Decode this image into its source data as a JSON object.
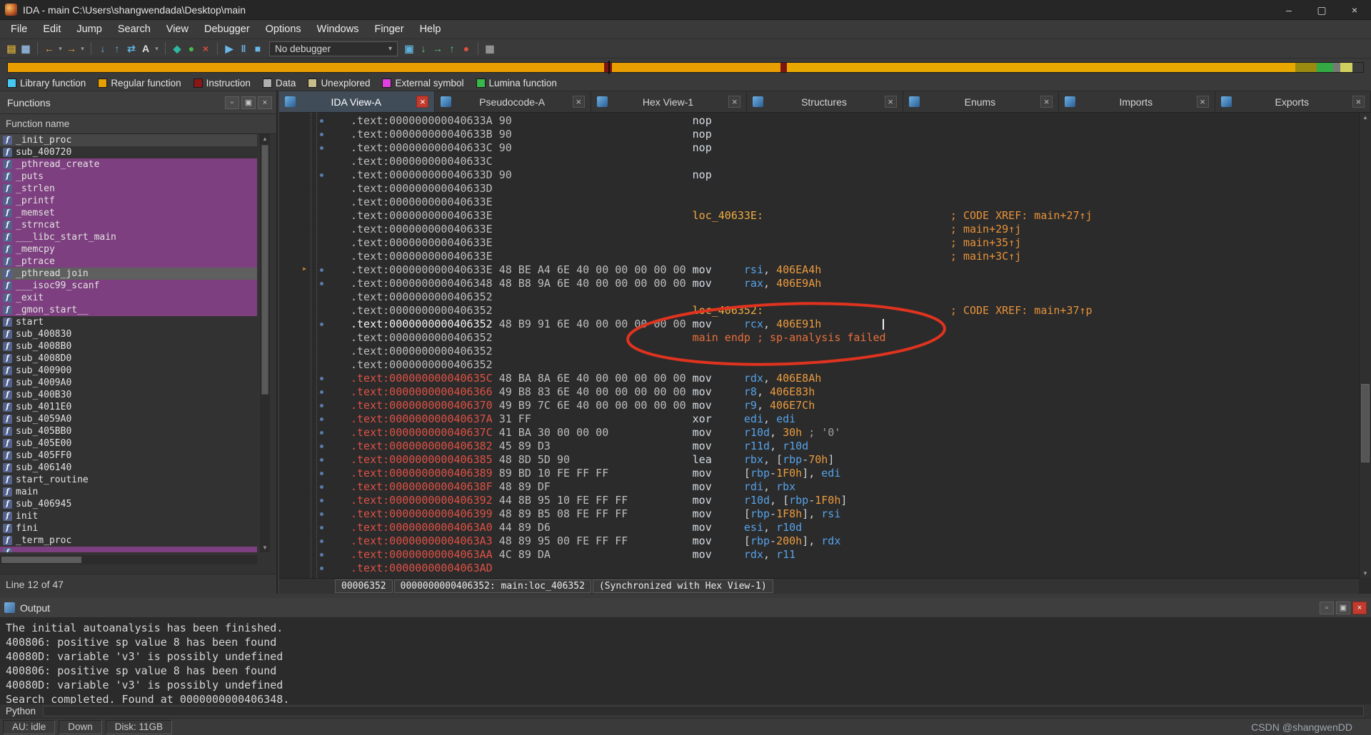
{
  "window": {
    "title": "IDA - main C:\\Users\\shangwendada\\Desktop\\main",
    "controls": [
      {
        "name": "minimize-button",
        "glyph": "–"
      },
      {
        "name": "maximize-button",
        "glyph": "▢"
      },
      {
        "name": "close-button",
        "glyph": "×"
      }
    ]
  },
  "menu": [
    "File",
    "Edit",
    "Jump",
    "Search",
    "View",
    "Debugger",
    "Options",
    "Windows",
    "Finger",
    "Help"
  ],
  "toolbar": {
    "debugger_combo": "No debugger",
    "icons_left": [
      {
        "name": "new-file-icon",
        "glyph": "▤",
        "color": "#caa43a"
      },
      {
        "name": "save-file-icon",
        "glyph": "▦",
        "color": "#8fb4d8"
      },
      {
        "sep": true
      },
      {
        "name": "navigate-back-icon",
        "glyph": "←",
        "color": "#e8a33d"
      },
      {
        "name": "navigate-back-dropdown-icon",
        "glyph": "▾",
        "color": "#9a9a9a",
        "small": true
      },
      {
        "name": "navigate-forward-icon",
        "glyph": "→",
        "color": "#e8a33d"
      },
      {
        "name": "navigate-forward-dropdown-icon",
        "glyph": "▾",
        "color": "#9a9a9a",
        "small": true
      },
      {
        "sep": true
      },
      {
        "name": "jump-to-address-icon",
        "glyph": "↓",
        "color": "#5fb0d8"
      },
      {
        "name": "jump-by-name-icon",
        "glyph": "↑",
        "color": "#5fb0d8"
      },
      {
        "name": "jump-xref-icon",
        "glyph": "⇄",
        "color": "#5fb0d8"
      },
      {
        "name": "search-text-icon",
        "glyph": "A",
        "color": "#e0e0e0"
      },
      {
        "name": "search-dropdown-icon",
        "glyph": "▾",
        "color": "#9a9a9a",
        "small": true
      },
      {
        "sep": true
      },
      {
        "name": "analysis-indicator-icon",
        "glyph": "◆",
        "color": "#2fb8a0"
      },
      {
        "name": "analysis-ok-icon",
        "glyph": "●",
        "color": "#4ab84a"
      },
      {
        "name": "cancel-analysis-icon",
        "glyph": "×",
        "color": "#d85040"
      },
      {
        "sep": true
      },
      {
        "name": "debugger-start-icon",
        "glyph": "▶",
        "color": "#6ab8e8"
      },
      {
        "name": "debugger-pause-icon",
        "glyph": "‖",
        "color": "#6ab8e8"
      },
      {
        "name": "debugger-stop-icon",
        "glyph": "■",
        "color": "#6ab8e8"
      }
    ],
    "icons_right": [
      {
        "name": "debugger-attach-icon",
        "glyph": "▣",
        "color": "#5fb0d8"
      },
      {
        "name": "step-into-icon",
        "glyph": "↓",
        "color": "#58c878"
      },
      {
        "name": "step-over-icon",
        "glyph": "→",
        "color": "#58c878"
      },
      {
        "name": "run-until-return-icon",
        "glyph": "↑",
        "color": "#58c878"
      },
      {
        "name": "breakpoints-icon",
        "glyph": "●",
        "color": "#d85040"
      },
      {
        "sep": true
      },
      {
        "name": "snapshot-icon",
        "glyph": "▦",
        "color": "#9a9a9a"
      }
    ]
  },
  "navband": {
    "segments": [
      {
        "c": "#e89e00",
        "w": "44%"
      },
      {
        "c": "#7d1414",
        "w": "0.6%"
      },
      {
        "c": "#e89e00",
        "w": "12.4%"
      },
      {
        "c": "#7d1414",
        "w": "0.5%"
      },
      {
        "c": "#e8a800",
        "w": "37.5%"
      },
      {
        "c": "#9a8a10",
        "w": "1.6%"
      },
      {
        "c": "#34aa44",
        "w": "1.2%"
      },
      {
        "c": "#777777",
        "w": "0.5%"
      },
      {
        "c": "#cfcf60",
        "w": "0.9%"
      },
      {
        "c": "#3a3a3a",
        "w": "0.8%"
      }
    ],
    "marker_pos": "44.3%"
  },
  "legend": [
    {
      "label": "Library function",
      "color": "#46c8f0"
    },
    {
      "label": "Regular function",
      "color": "#e8a000"
    },
    {
      "label": "Instruction",
      "color": "#8a1616"
    },
    {
      "label": "Data",
      "color": "#b0b0b0"
    },
    {
      "label": "Unexplored",
      "color": "#c8bc8a"
    },
    {
      "label": "External symbol",
      "color": "#e040e0"
    },
    {
      "label": "Lumina function",
      "color": "#38b848"
    }
  ],
  "tabs": [
    {
      "label": "IDA View-A",
      "active": true
    },
    {
      "label": "Pseudocode-A",
      "active": false
    },
    {
      "label": "Hex View-1",
      "active": false
    },
    {
      "label": "Structures",
      "active": false
    },
    {
      "label": "Enums",
      "active": false
    },
    {
      "label": "Imports",
      "active": false
    },
    {
      "label": "Exports",
      "active": false
    }
  ],
  "functions_panel": {
    "title": "Functions",
    "column_header": "Function name",
    "status": "Line 12 of 47",
    "buttons": [
      {
        "name": "restore-button",
        "glyph": "▫"
      },
      {
        "name": "float-button",
        "glyph": "▣"
      },
      {
        "name": "close-button",
        "glyph": "×"
      }
    ],
    "items": [
      {
        "name": "_init_proc",
        "style": "focus"
      },
      {
        "name": "sub_400720",
        "style": ""
      },
      {
        "name": "_pthread_create",
        "style": "lib"
      },
      {
        "name": "_puts",
        "style": "lib"
      },
      {
        "name": "_strlen",
        "style": "lib"
      },
      {
        "name": "_printf",
        "style": "lib"
      },
      {
        "name": "_memset",
        "style": "lib"
      },
      {
        "name": "_strncat",
        "style": "lib"
      },
      {
        "name": "___libc_start_main",
        "style": "lib"
      },
      {
        "name": "_memcpy",
        "style": "lib"
      },
      {
        "name": "_ptrace",
        "style": "lib"
      },
      {
        "name": "_pthread_join",
        "style": "selected"
      },
      {
        "name": "___isoc99_scanf",
        "style": "lib"
      },
      {
        "name": "_exit",
        "style": "lib"
      },
      {
        "name": "_gmon_start__",
        "style": "lib"
      },
      {
        "name": "start",
        "style": ""
      },
      {
        "name": "sub_400830",
        "style": ""
      },
      {
        "name": "sub_4008B0",
        "style": ""
      },
      {
        "name": "sub_4008D0",
        "style": ""
      },
      {
        "name": "sub_400900",
        "style": ""
      },
      {
        "name": "sub_4009A0",
        "style": ""
      },
      {
        "name": "sub_400B30",
        "style": ""
      },
      {
        "name": "sub_4011E0",
        "style": ""
      },
      {
        "name": "sub_4059A0",
        "style": ""
      },
      {
        "name": "sub_405BB0",
        "style": ""
      },
      {
        "name": "sub_405E00",
        "style": ""
      },
      {
        "name": "sub_405FF0",
        "style": ""
      },
      {
        "name": "sub_406140",
        "style": ""
      },
      {
        "name": "start_routine",
        "style": ""
      },
      {
        "name": "main",
        "style": ""
      },
      {
        "name": "sub_406945",
        "style": ""
      },
      {
        "name": "init",
        "style": ""
      },
      {
        "name": "fini",
        "style": ""
      },
      {
        "name": "_term_proc",
        "style": ""
      },
      {
        "name": "",
        "style": "lib"
      }
    ]
  },
  "disasm": {
    "status": [
      "00006352",
      "0000000000406352: main:loc_406352",
      "(Synchronized with Hex View-1)"
    ],
    "annotation_color": "#e0331f",
    "lines": [
      {
        "addr": ".text:000000000040633A",
        "bytes": "90",
        "mnem": "nop",
        "dot": true
      },
      {
        "addr": ".text:000000000040633B",
        "bytes": "90",
        "mnem": "nop",
        "dot": true
      },
      {
        "addr": ".text:000000000040633C",
        "bytes": "90",
        "mnem": "nop",
        "dot": true
      },
      {
        "addr": ".text:000000000040633C"
      },
      {
        "addr": ".text:000000000040633D",
        "bytes": "90",
        "mnem": "nop",
        "dot": true
      },
      {
        "addr": ".text:000000000040633D"
      },
      {
        "addr": ".text:000000000040633E"
      },
      {
        "addr": ".text:000000000040633E",
        "label": "loc_40633E:",
        "comment": "; CODE XREF: main+27↑j"
      },
      {
        "addr": ".text:000000000040633E",
        "comment": "; main+29↑j"
      },
      {
        "addr": ".text:000000000040633E",
        "comment": "; main+35↑j"
      },
      {
        "addr": ".text:000000000040633E",
        "comment": "; main+3C↑j"
      },
      {
        "addr": ".text:000000000040633E",
        "bytes": "48 BE A4 6E 40 00 00 00 00 00",
        "mnem": "mov",
        "ops": [
          [
            "rsi",
            "r"
          ],
          [
            ", ",
            "w"
          ],
          [
            "406EA4h",
            "n"
          ]
        ],
        "dot": true,
        "arrow": true
      },
      {
        "addr": ".text:0000000000406348",
        "bytes": "48 B8 9A 6E 40 00 00 00 00 00",
        "mnem": "mov",
        "ops": [
          [
            "rax",
            "r"
          ],
          [
            ", ",
            "w"
          ],
          [
            "406E9Ah",
            "n"
          ]
        ],
        "dot": true
      },
      {
        "addr": ".text:0000000000406352"
      },
      {
        "addr": ".text:0000000000406352",
        "label": "loc_406352:",
        "comment": "; CODE XREF: main+37↑p"
      },
      {
        "addr": ".text:0000000000406352",
        "ac": "aw",
        "bytes": "48 B9 91 6E 40 00 00 00 00 00",
        "mnem": "mov",
        "ops": [
          [
            "rcx",
            "r"
          ],
          [
            ", ",
            "w"
          ],
          [
            "406E91h",
            "n"
          ]
        ],
        "dot": true,
        "cursor": true
      },
      {
        "addr": ".text:0000000000406352",
        "raw": [
          [
            "main endp ; sp-analysis failed",
            "e"
          ]
        ]
      },
      {
        "addr": ".text:0000000000406352"
      },
      {
        "addr": ".text:0000000000406352"
      },
      {
        "addr": ".text:000000000040635C",
        "ac": "ar",
        "bytes": "48 BA 8A 6E 40 00 00 00 00 00",
        "mnem": "mov",
        "ops": [
          [
            "rdx",
            "r"
          ],
          [
            ", ",
            "w"
          ],
          [
            "406E8Ah",
            "n"
          ]
        ],
        "dot": true
      },
      {
        "addr": ".text:0000000000406366",
        "ac": "ar",
        "bytes": "49 B8 83 6E 40 00 00 00 00 00",
        "mnem": "mov",
        "ops": [
          [
            "r8",
            "r"
          ],
          [
            ", ",
            "w"
          ],
          [
            "406E83h",
            "n"
          ]
        ],
        "dot": true
      },
      {
        "addr": ".text:0000000000406370",
        "ac": "ar",
        "bytes": "49 B9 7C 6E 40 00 00 00 00 00",
        "mnem": "mov",
        "ops": [
          [
            "r9",
            "r"
          ],
          [
            ", ",
            "w"
          ],
          [
            "406E7Ch",
            "n"
          ]
        ],
        "dot": true
      },
      {
        "addr": ".text:000000000040637A",
        "ac": "ar",
        "bytes": "31 FF",
        "mnem": "xor",
        "ops": [
          [
            "edi",
            "r"
          ],
          [
            ", ",
            "w"
          ],
          [
            "edi",
            "r"
          ]
        ],
        "dot": true
      },
      {
        "addr": ".text:000000000040637C",
        "ac": "ar",
        "bytes": "41 BA 30 00 00 00",
        "mnem": "mov",
        "ops": [
          [
            "r10d",
            "r"
          ],
          [
            ", ",
            "w"
          ],
          [
            "30h",
            "n"
          ],
          [
            " ",
            "w"
          ],
          [
            "; '0'",
            "g"
          ]
        ],
        "dot": true
      },
      {
        "addr": ".text:0000000000406382",
        "ac": "ar",
        "bytes": "45 89 D3",
        "mnem": "mov",
        "ops": [
          [
            "r11d",
            "r"
          ],
          [
            ", ",
            "w"
          ],
          [
            "r10d",
            "r"
          ]
        ],
        "dot": true
      },
      {
        "addr": ".text:0000000000406385",
        "ac": "ar",
        "bytes": "48 8D 5D 90",
        "mnem": "lea",
        "ops": [
          [
            "rbx",
            "r"
          ],
          [
            ", [",
            "w"
          ],
          [
            "rbp",
            "r"
          ],
          [
            "-",
            "w"
          ],
          [
            "70h",
            "n"
          ],
          [
            "]",
            "w"
          ]
        ],
        "dot": true
      },
      {
        "addr": ".text:0000000000406389",
        "ac": "ar",
        "bytes": "89 BD 10 FE FF FF",
        "mnem": "mov",
        "ops": [
          [
            "[",
            "w"
          ],
          [
            "rbp",
            "r"
          ],
          [
            "-",
            "w"
          ],
          [
            "1F0h",
            "n"
          ],
          [
            "]",
            "w"
          ],
          [
            ", ",
            "w"
          ],
          [
            "edi",
            "r"
          ]
        ],
        "dot": true
      },
      {
        "addr": ".text:000000000040638F",
        "ac": "ar",
        "bytes": "48 89 DF",
        "mnem": "mov",
        "ops": [
          [
            "rdi",
            "r"
          ],
          [
            ", ",
            "w"
          ],
          [
            "rbx",
            "r"
          ]
        ],
        "dot": true
      },
      {
        "addr": ".text:0000000000406392",
        "ac": "ar",
        "bytes": "44 8B 95 10 FE FF FF",
        "mnem": "mov",
        "ops": [
          [
            "r10d",
            "r"
          ],
          [
            ", [",
            "w"
          ],
          [
            "rbp",
            "r"
          ],
          [
            "-",
            "w"
          ],
          [
            "1F0h",
            "n"
          ],
          [
            "]",
            "w"
          ]
        ],
        "dot": true
      },
      {
        "addr": ".text:0000000000406399",
        "ac": "ar",
        "bytes": "48 89 B5 08 FE FF FF",
        "mnem": "mov",
        "ops": [
          [
            "[",
            "w"
          ],
          [
            "rbp",
            "r"
          ],
          [
            "-",
            "w"
          ],
          [
            "1F8h",
            "n"
          ],
          [
            "]",
            "w"
          ],
          [
            ", ",
            "w"
          ],
          [
            "rsi",
            "r"
          ]
        ],
        "dot": true
      },
      {
        "addr": ".text:00000000004063A0",
        "ac": "ar",
        "bytes": "44 89 D6",
        "mnem": "mov",
        "ops": [
          [
            "esi",
            "r"
          ],
          [
            ", ",
            "w"
          ],
          [
            "r10d",
            "r"
          ]
        ],
        "dot": true
      },
      {
        "addr": ".text:00000000004063A3",
        "ac": "ar",
        "bytes": "48 89 95 00 FE FF FF",
        "mnem": "mov",
        "ops": [
          [
            "[",
            "w"
          ],
          [
            "rbp",
            "r"
          ],
          [
            "-",
            "w"
          ],
          [
            "200h",
            "n"
          ],
          [
            "]",
            "w"
          ],
          [
            ", ",
            "w"
          ],
          [
            "rdx",
            "r"
          ]
        ],
        "dot": true
      },
      {
        "addr": ".text:00000000004063AA",
        "ac": "ar",
        "bytes": "4C 89 DA",
        "mnem": "mov",
        "ops": [
          [
            "rdx",
            "r"
          ],
          [
            ", ",
            "w"
          ],
          [
            "r11",
            "r"
          ]
        ],
        "dot": true
      },
      {
        "addr": ".text:00000000004063AD",
        "ac": "ar",
        "dot": true
      }
    ]
  },
  "output": {
    "title": "Output",
    "prompt": "Python",
    "buttons": [
      {
        "name": "maximize-button",
        "glyph": "▫"
      },
      {
        "name": "dock-button",
        "glyph": "▣"
      },
      {
        "name": "close-button",
        "glyph": "×",
        "red": true
      }
    ],
    "lines": [
      "The initial autoanalysis has been finished.",
      "400806: positive sp value 8 has been found",
      "40080D: variable 'v3' is possibly undefined",
      "400806: positive sp value 8 has been found",
      "40080D: variable 'v3' is possibly undefined",
      "Search completed. Found at 0000000000406348."
    ]
  },
  "statusbar": {
    "items": [
      "AU: idle",
      "Down",
      "Disk: 11GB"
    ],
    "watermark": "CSDN @shangwenDD"
  }
}
